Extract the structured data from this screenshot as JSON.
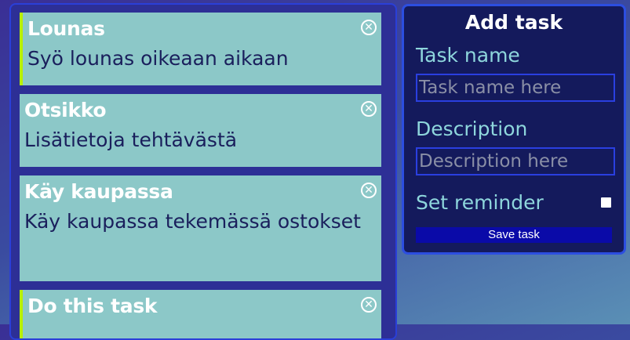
{
  "tasks": [
    {
      "title": "Lounas",
      "description": "Syö lounas oikeaan aikaan",
      "reminder": true
    },
    {
      "title": "Otsikko",
      "description": "Lisätietoja tehtävästä",
      "reminder": false
    },
    {
      "title": "Käy kaupassa",
      "description": "Käy kaupassa tekemässä ostokset",
      "reminder": false
    },
    {
      "title": "Do this task",
      "description": "",
      "reminder": true
    }
  ],
  "delete_icon": "close-circle-icon",
  "form": {
    "title": "Add task",
    "name_label": "Task name",
    "name_placeholder": "Task name here",
    "description_label": "Description",
    "description_placeholder": "Description here",
    "reminder_label": "Set reminder",
    "reminder_checked": false,
    "save_label": "Save task"
  },
  "colors": {
    "reminder_accent": "#b8f000",
    "task_background": "#8cc8c8",
    "save_button": "#0a0aa8",
    "form_label": "#8ed6dc"
  }
}
